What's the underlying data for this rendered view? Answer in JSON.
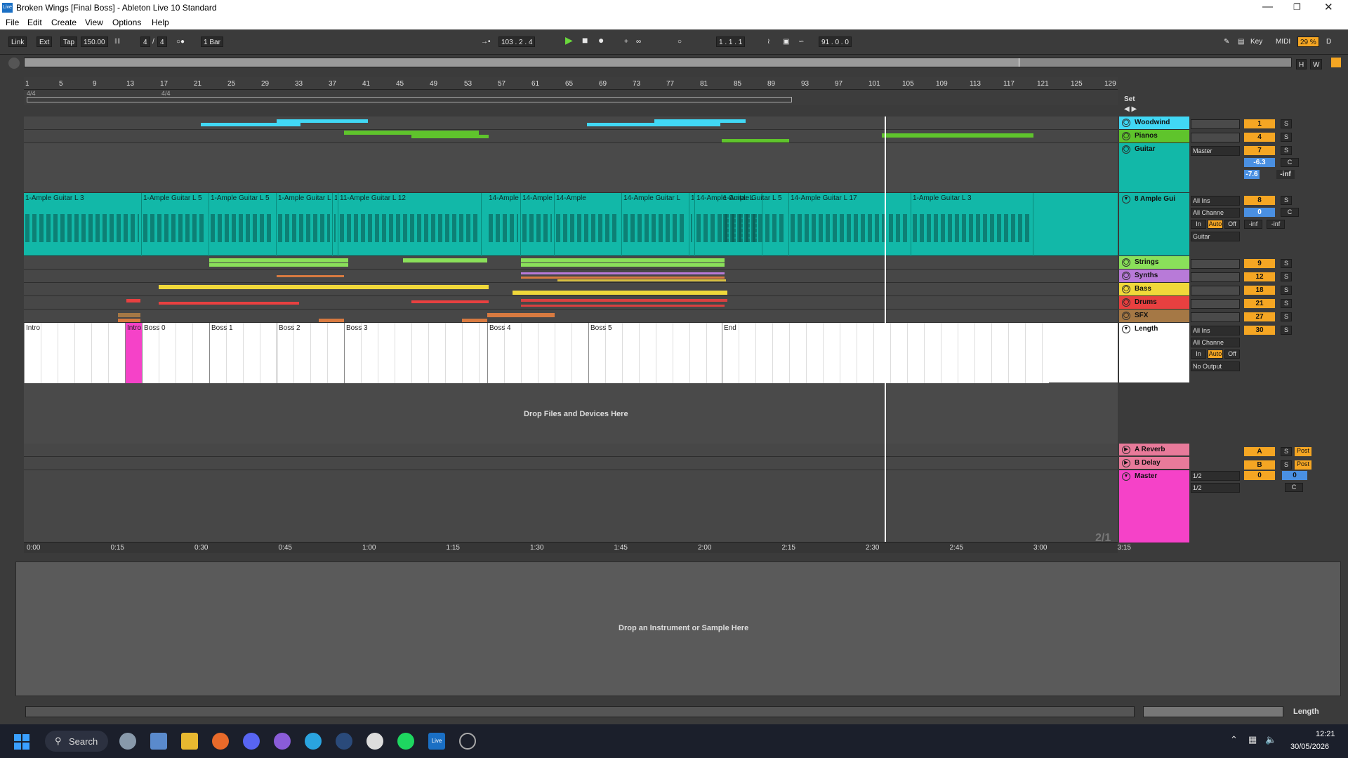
{
  "window": {
    "title": "Broken Wings  [Final Boss] - Ableton Live 10 Standard",
    "logo": "Live",
    "controls": [
      "minimize-icon",
      "maximize-icon",
      "close-icon"
    ]
  },
  "menu": [
    "File",
    "Edit",
    "Create",
    "View",
    "Options",
    "Help"
  ],
  "transport": {
    "link": "Link",
    "ext": "Ext",
    "tap": "Tap",
    "tempo": "150.00",
    "sig_num": "4",
    "sig_den": "4",
    "quant": "1 Bar",
    "position": "103 .  2 .  4",
    "loop_start": "1 .  1 .  1",
    "loop_len": "91 .  0 .  0",
    "key": "Key",
    "midi": "MIDI",
    "cpu": "29 %",
    "disk": "D",
    "h": "H",
    "w": "W"
  },
  "ruler": {
    "bars": [
      "1",
      "5",
      "9",
      "13",
      "17",
      "21",
      "25",
      "29",
      "33",
      "37",
      "41",
      "45",
      "49",
      "53",
      "57",
      "61",
      "65",
      "69",
      "73",
      "77",
      "81",
      "85",
      "89",
      "93",
      "97",
      "101",
      "105",
      "109",
      "113",
      "117",
      "121",
      "125",
      "129"
    ],
    "sig": "4/4",
    "sig2": "4/4",
    "set": "Set"
  },
  "tracks": [
    {
      "name": "Woodwind",
      "color": "#41d8f5",
      "vol": "1",
      "solo": "S"
    },
    {
      "name": "Pianos",
      "color": "#5fc42c",
      "vol": "4",
      "solo": "S"
    },
    {
      "name": "Guitar",
      "color": "#12b8a8",
      "vol": "7",
      "solo": "S",
      "io": "Master",
      "vol_db": "-6.3",
      "pan": "C",
      "peak": "-7.6",
      "peak2": "-inf"
    },
    {
      "name": "8 Ample Gui",
      "color": "#12b8a8",
      "vol": "8",
      "solo": "S",
      "in1": "All Ins",
      "in2": "All Channe",
      "mon_in": "In",
      "mon_auto": "Auto",
      "mon_off": "Off",
      "out": "Guitar",
      "vdb": "0",
      "pan": "C",
      "m1": "-inf",
      "m2": "-inf"
    },
    {
      "name": "Strings",
      "color": "#8ae05a",
      "vol": "9",
      "solo": "S"
    },
    {
      "name": "Synths",
      "color": "#b87ad8",
      "vol": "12",
      "solo": "S"
    },
    {
      "name": "Bass",
      "color": "#f0d83a",
      "vol": "18",
      "solo": "S"
    },
    {
      "name": "Drums",
      "color": "#e84040",
      "vol": "21",
      "solo": "S"
    },
    {
      "name": "SFX",
      "color": "#a57845",
      "vol": "27",
      "solo": "S"
    },
    {
      "name": "Length",
      "color": "#ffffff",
      "vol": "30",
      "solo": "S",
      "in1": "All Ins",
      "in2": "All Channe",
      "mon_in": "In",
      "mon_auto": "Auto",
      "mon_off": "Off",
      "out": "No Output"
    }
  ],
  "guitar_clips": [
    "1-Ample Guitar L 3",
    "1-Ample Guitar L 5",
    "1-Ample Guitar L 5",
    "1-Ample Guitar L",
    "1-",
    "11-Ample Guitar L 12",
    "14-Ample",
    "14-Ample",
    "14-Ample",
    "14-Ample Guitar L",
    "1-",
    "14-Ample Guitar L",
    "1-Ample Guitar L 5",
    "14-Ample Guitar L 17",
    "1-Ample Guitar L 3"
  ],
  "sections": [
    "Intro",
    "Intro",
    "Boss 0",
    "Boss 1",
    "Boss 2",
    "Boss 3",
    "Boss 4",
    "Boss 5",
    "End"
  ],
  "drop_files": "Drop Files and Devices Here",
  "returns": [
    {
      "name": "A Reverb",
      "color": "#e87a9a",
      "vol": "A",
      "solo": "S",
      "post": "Post"
    },
    {
      "name": "B Delay",
      "color": "#e87a9a",
      "vol": "B",
      "solo": "S",
      "post": "Post"
    }
  ],
  "master": {
    "name": "Master",
    "color": "#f542c8",
    "io1": "1/2",
    "io2": "1/2",
    "vol": "0",
    "vol2": "0",
    "pan": "C"
  },
  "zoom": "2/1",
  "time": [
    "0:00",
    "0:15",
    "0:30",
    "0:45",
    "1:00",
    "1:15",
    "1:30",
    "1:45",
    "2:00",
    "2:15",
    "2:30",
    "2:45",
    "3:00",
    "3:15"
  ],
  "detail_drop": "Drop an Instrument or Sample Here",
  "bottom_label": "Length",
  "taskbar": {
    "search": "Search",
    "time": "12:21",
    "date": "30/05/2026"
  }
}
